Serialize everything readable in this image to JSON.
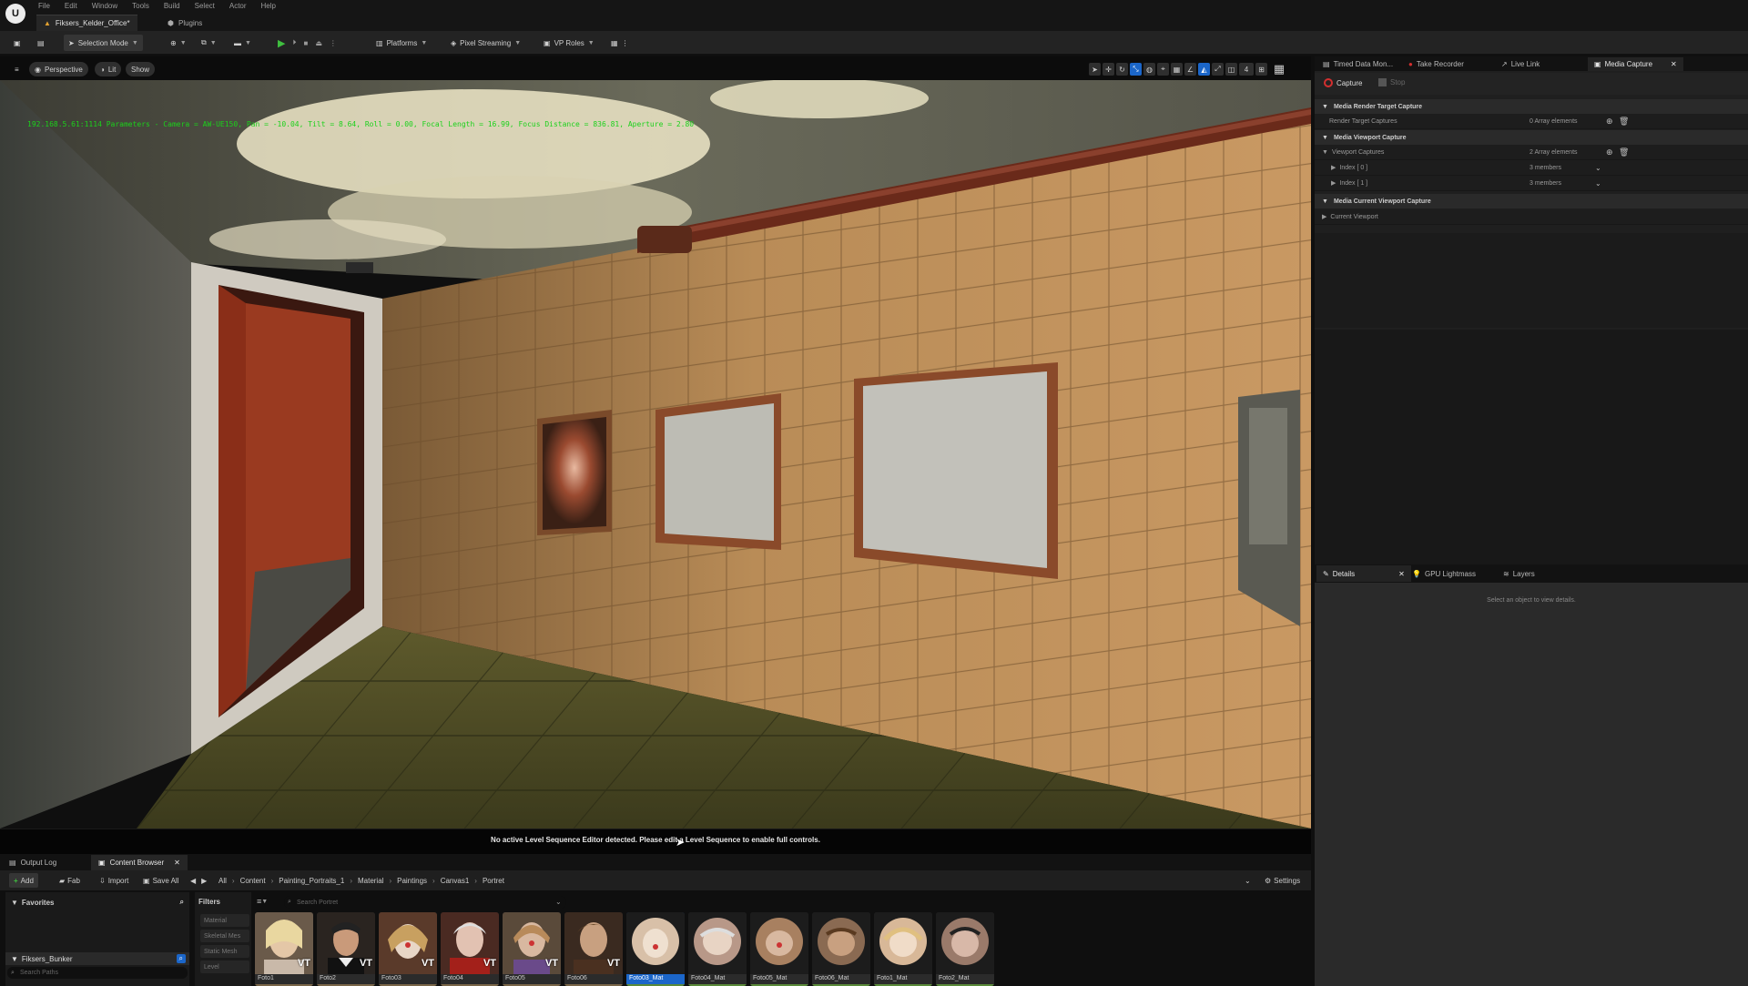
{
  "menubar": {
    "items": [
      "File",
      "Edit",
      "Window",
      "Tools",
      "Build",
      "Select",
      "Actor",
      "Help"
    ]
  },
  "tabs": {
    "level": "Fiksers_Kelder_Office*",
    "plugins": "Plugins"
  },
  "toolbar": {
    "selection_mode": "Selection Mode",
    "platforms": "Platforms",
    "pixel_streaming": "Pixel Streaming",
    "vp_roles": "VP Roles"
  },
  "viewport": {
    "perspective": "Perspective",
    "lit": "Lit",
    "show": "Show",
    "camera_speed": "4",
    "hud": "192.168.5.61:1114 Parameters - Camera = AW-UE150, Pan = -10.04, Tilt = 8.64, Roll = 0.00, Focal Length = 16.99, Focus Distance = 836.81, Aperture = 2.80",
    "message": "No active Level Sequence Editor detected. Please edit a Level Sequence to enable full controls."
  },
  "right_tabs": {
    "timed_data": "Timed Data Mon...",
    "take_recorder": "Take Recorder",
    "live_link": "Live Link",
    "media_capture": "Media Capture"
  },
  "media_capture": {
    "capture": "Capture",
    "stop": "Stop",
    "sections": {
      "render_target": "Media Render Target Capture",
      "viewport": "Media Viewport Capture",
      "current_viewport": "Media Current Viewport Capture"
    },
    "rows": {
      "render_target_captures": "Render Target Captures",
      "render_target_value": "0 Array elements",
      "viewport_captures": "Viewport Captures",
      "viewport_value": "2 Array elements",
      "index0": "Index [ 0 ]",
      "index1": "Index [ 1 ]",
      "members": "3 members",
      "current_viewport": "Current Viewport"
    }
  },
  "details_tabs": {
    "details": "Details",
    "gpu_lightmass": "GPU Lightmass",
    "layers": "Layers"
  },
  "details_message": "Select an object to view details.",
  "bottom_tabs": {
    "output_log": "Output Log",
    "content_browser": "Content Browser"
  },
  "content_browser": {
    "add": "Add",
    "fab": "Fab",
    "import": "Import",
    "save_all": "Save All",
    "breadcrumbs": [
      "All",
      "Content",
      "Painting_Portraits_1",
      "Material",
      "Paintings",
      "Canvas1",
      "Portret"
    ],
    "settings": "Settings",
    "favorites": "Favorites",
    "project": "Fiksers_Bunker",
    "search_paths": "Search Paths",
    "filters": "Filters",
    "filter_items": [
      "Material",
      "Skeletal Mes",
      "Static Mesh",
      "Level"
    ],
    "search_placeholder": "Search Portret",
    "assets": [
      {
        "label": "Foto1",
        "type": "texture"
      },
      {
        "label": "Foto2",
        "type": "texture"
      },
      {
        "label": "Foto03",
        "type": "texture"
      },
      {
        "label": "Foto04",
        "type": "texture"
      },
      {
        "label": "Foto05",
        "type": "texture"
      },
      {
        "label": "Foto06",
        "type": "texture"
      },
      {
        "label": "Foto03_Mat",
        "type": "material"
      },
      {
        "label": "Foto04_Mat",
        "type": "material"
      },
      {
        "label": "Foto05_Mat",
        "type": "material"
      },
      {
        "label": "Foto06_Mat",
        "type": "material"
      },
      {
        "label": "Foto1_Mat",
        "type": "material"
      },
      {
        "label": "Foto2_Mat",
        "type": "material"
      }
    ],
    "vt_badge": "VT"
  },
  "colors": {
    "accent": "#1b66c9",
    "play": "#3fbf3f",
    "hud": "#1bd11b",
    "record": "#d32f2f"
  }
}
